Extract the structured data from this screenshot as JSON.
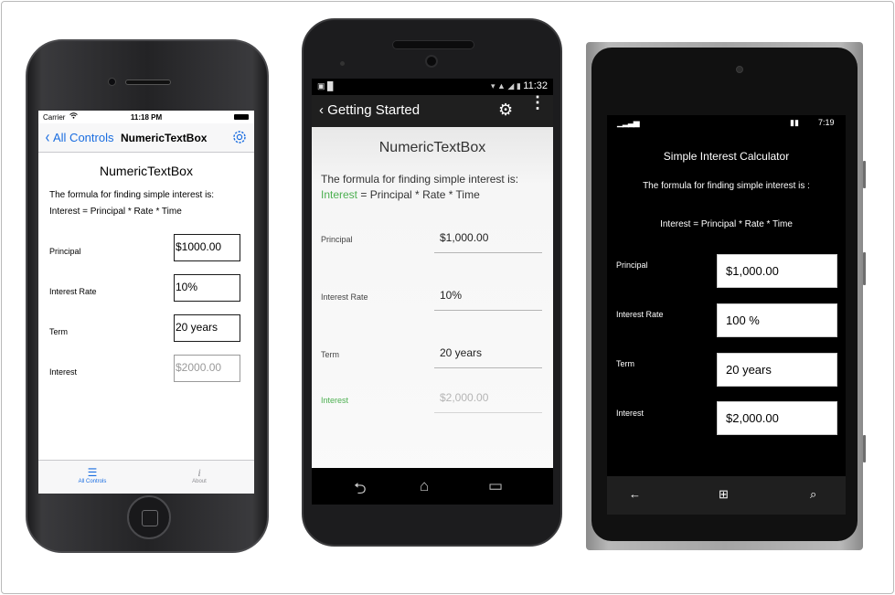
{
  "ios": {
    "status": {
      "carrier": "Carrier",
      "time": "11:18 PM"
    },
    "nav": {
      "back_label": "All Controls",
      "title": "NumericTextBox"
    },
    "heading": "NumericTextBox",
    "formula_line1": "The formula for finding simple interest is:",
    "formula_line2": "Interest = Principal * Rate * Time",
    "fields": [
      {
        "label": "Principal",
        "value": "$1000.00"
      },
      {
        "label": "Interest Rate",
        "value": "10%"
      },
      {
        "label": "Term",
        "value": "20 years"
      },
      {
        "label": "Interest",
        "value": "$2000.00"
      }
    ],
    "tabs": [
      {
        "label": "All Controls",
        "icon": "list-icon"
      },
      {
        "label": "About",
        "icon": "info-icon"
      }
    ],
    "accent": "#1a6de0"
  },
  "android": {
    "status": {
      "time": "11:32"
    },
    "action_bar": {
      "title": "Getting Started"
    },
    "heading": "NumericTextBox",
    "formula_line1": "The formula for finding simple interest is:",
    "formula_interest": "Interest",
    "formula_rest": " = Principal * Rate * Time",
    "fields": [
      {
        "label": "Principal",
        "value": "$1,000.00"
      },
      {
        "label": "Interest Rate",
        "value": "10%"
      },
      {
        "label": "Term",
        "value": "20 years"
      },
      {
        "label": "Interest",
        "value": "$2,000.00"
      }
    ],
    "accent": "#4caf50"
  },
  "winphone": {
    "status": {
      "time": "7:19"
    },
    "title": "Simple Interest Calculator",
    "formula_line1": "The formula for finding simple interest is :",
    "formula_line2": "Interest = Principal * Rate * Time",
    "fields": [
      {
        "label": "Principal",
        "value": "$1,000.00"
      },
      {
        "label": "Interest Rate",
        "value": "100 %"
      },
      {
        "label": "Term",
        "value": "20 years"
      },
      {
        "label": "Interest",
        "value": "$2,000.00"
      }
    ]
  }
}
